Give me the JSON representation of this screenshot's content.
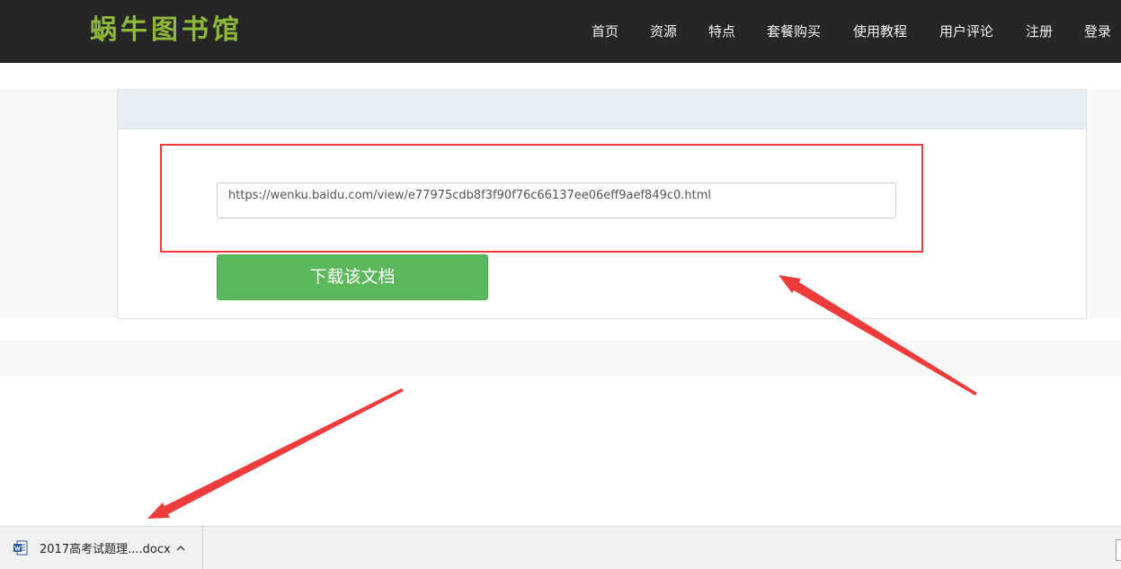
{
  "header": {
    "logo_text": "蜗牛图书馆",
    "nav": [
      "首页",
      "资源",
      "特点",
      "套餐购买",
      "使用教程",
      "用户评论",
      "注册",
      "登录"
    ]
  },
  "form": {
    "url_value": "https://wenku.baidu.com/view/e77975cdb8f3f90f76c66137ee06eff9aef849c0.html",
    "download_label": "下载该文档"
  },
  "download_bar": {
    "file_name": "2017高考试题理....docx",
    "file_icon": "word-document-icon",
    "expand_icon": "chevron-up-icon"
  },
  "colors": {
    "header_bg": "#262626",
    "logo": "#8cb83c",
    "button": "#5cb85c",
    "annotation": "#ee3b3b"
  }
}
